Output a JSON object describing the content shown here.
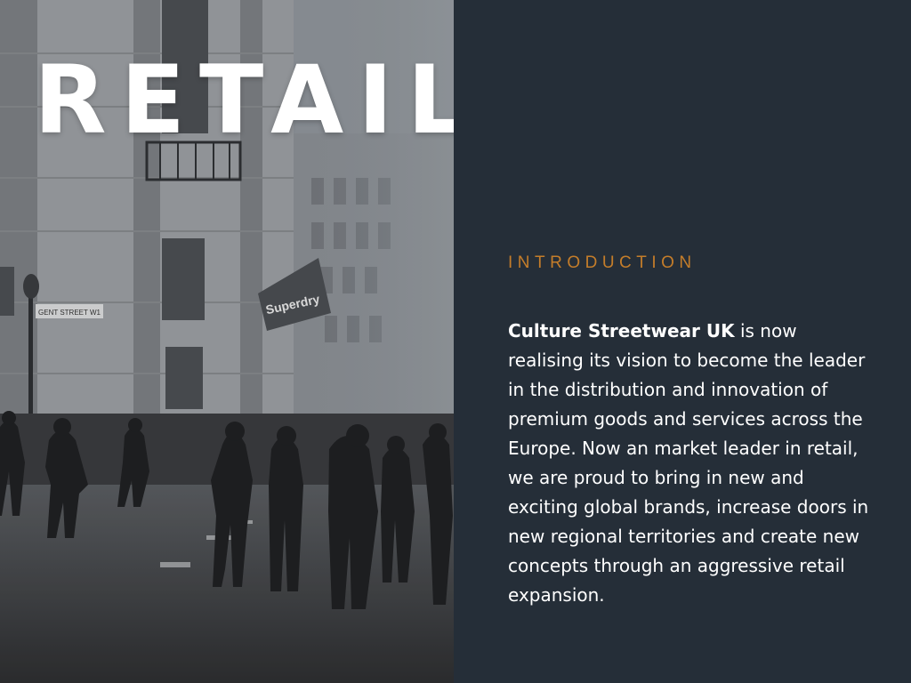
{
  "photo": {
    "title": "RETAIL",
    "shop_sign": "Superdry",
    "street_sign": "GENT STREET W1"
  },
  "intro": {
    "heading": "INTRODUCTION",
    "company": "Culture Streetwear UK",
    "body": " is now realising its vision to become the leader in the distribution and innovation of premium goods and services across the Europe. Now an market leader in retail, we are proud to bring in new and exciting global brands, increase doors in new regional territories and create new concepts through an aggressive retail expansion."
  },
  "colors": {
    "panel_background": "#252e38",
    "accent": "#c47d2a",
    "text": "#ffffff"
  }
}
